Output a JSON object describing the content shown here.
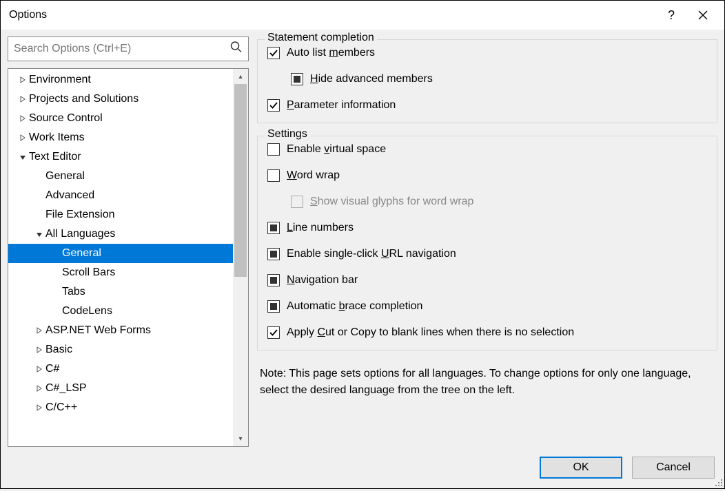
{
  "window": {
    "title": "Options"
  },
  "search": {
    "placeholder": "Search Options (Ctrl+E)"
  },
  "tree": {
    "items": [
      {
        "label": "Environment",
        "depth": 0,
        "exp": "collapsed"
      },
      {
        "label": "Projects and Solutions",
        "depth": 0,
        "exp": "collapsed"
      },
      {
        "label": "Source Control",
        "depth": 0,
        "exp": "collapsed"
      },
      {
        "label": "Work Items",
        "depth": 0,
        "exp": "collapsed"
      },
      {
        "label": "Text Editor",
        "depth": 0,
        "exp": "expanded"
      },
      {
        "label": "General",
        "depth": 1,
        "exp": "none"
      },
      {
        "label": "Advanced",
        "depth": 1,
        "exp": "none"
      },
      {
        "label": "File Extension",
        "depth": 1,
        "exp": "none"
      },
      {
        "label": "All Languages",
        "depth": 1,
        "exp": "expanded"
      },
      {
        "label": "General",
        "depth": 2,
        "exp": "none",
        "selected": true
      },
      {
        "label": "Scroll Bars",
        "depth": 2,
        "exp": "none"
      },
      {
        "label": "Tabs",
        "depth": 2,
        "exp": "none"
      },
      {
        "label": "CodeLens",
        "depth": 2,
        "exp": "none"
      },
      {
        "label": "ASP.NET Web Forms",
        "depth": 1,
        "exp": "collapsed"
      },
      {
        "label": "Basic",
        "depth": 1,
        "exp": "collapsed"
      },
      {
        "label": "C#",
        "depth": 1,
        "exp": "collapsed"
      },
      {
        "label": "C#_LSP",
        "depth": 1,
        "exp": "collapsed"
      },
      {
        "label": "C/C++",
        "depth": 1,
        "exp": "collapsed"
      }
    ]
  },
  "group1": {
    "title": "Statement completion",
    "opts": [
      {
        "pre": "Auto list ",
        "u": "m",
        "post": "embers",
        "state": "checked",
        "indent": false
      },
      {
        "pre": "",
        "u": "H",
        "post": "ide advanced members",
        "state": "indeterminate",
        "indent": true
      },
      {
        "pre": "",
        "u": "P",
        "post": "arameter information",
        "state": "checked",
        "indent": false
      }
    ]
  },
  "group2": {
    "title": "Settings",
    "opts": [
      {
        "pre": "Enable ",
        "u": "v",
        "post": "irtual space",
        "state": "unchecked",
        "indent": false
      },
      {
        "pre": "",
        "u": "W",
        "post": "ord wrap",
        "state": "unchecked",
        "indent": false
      },
      {
        "pre": "",
        "u": "S",
        "post": "how visual glyphs for word wrap",
        "state": "unchecked",
        "indent": true,
        "disabled": true
      },
      {
        "pre": "",
        "u": "L",
        "post": "ine numbers",
        "state": "indeterminate",
        "indent": false
      },
      {
        "pre": "Enable single-click ",
        "u": "U",
        "post": "RL navigation",
        "state": "indeterminate",
        "indent": false
      },
      {
        "pre": "",
        "u": "N",
        "post": "avigation bar",
        "state": "indeterminate",
        "indent": false
      },
      {
        "pre": "Automatic ",
        "u": "b",
        "post": "race completion",
        "state": "indeterminate",
        "indent": false
      },
      {
        "pre": "Apply ",
        "u": "C",
        "post": "ut or Copy to blank lines when there is no selection",
        "state": "checked",
        "indent": false
      }
    ]
  },
  "note": "Note: This page sets options for all languages. To change options for only one language, select the desired language from the tree on the left.",
  "buttons": {
    "ok": "OK",
    "cancel": "Cancel"
  }
}
